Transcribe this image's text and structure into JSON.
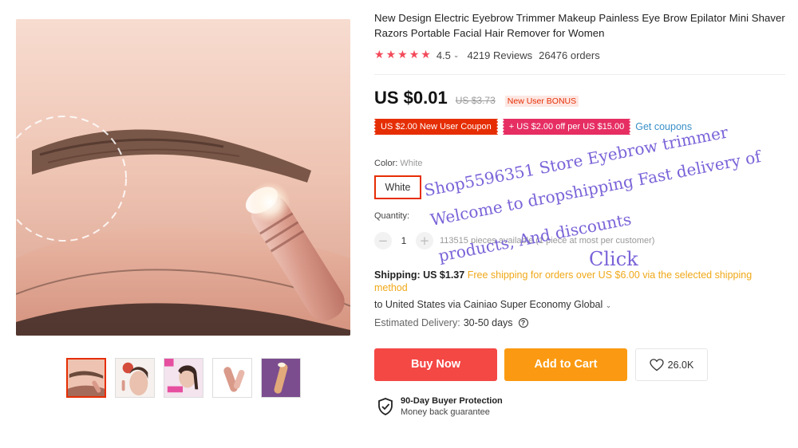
{
  "product": {
    "title": "New Design Electric Eyebrow Trimmer Makeup Painless Eye Brow Epilator Mini Shaver Razors Portable Facial Hair Remover for Women",
    "rating": "4.5",
    "reviews": "4219 Reviews",
    "orders": "26476 orders",
    "stars_filled": 5
  },
  "price": {
    "current": "US $0.01",
    "original": "US $3.73",
    "bonus_tag": "New User BONUS"
  },
  "coupons": {
    "new_user": "US $2.00 New User Coupon",
    "store": "+ US $2.00 off per US $15.00",
    "get_link": "Get coupons"
  },
  "color": {
    "label": "Color:",
    "selected": "White",
    "option": "White"
  },
  "quantity": {
    "label": "Quantity:",
    "value": "1",
    "minus": "−",
    "plus": "+",
    "stock": "113515 pieces available (1 piece at most per customer)"
  },
  "shipping": {
    "label": "Shipping: US $1.37",
    "free_text": "Free shipping for orders over US $6.00 via the selected shipping method",
    "to": "to United States via Cainiao Super Economy Global",
    "delivery_label": "Estimated Delivery:",
    "delivery_days": "30-50 days"
  },
  "actions": {
    "buy_now": "Buy Now",
    "add_to_cart": "Add to Cart",
    "wishlist_count": "26.0K"
  },
  "protection": {
    "title": "90-Day Buyer Protection",
    "subtitle": "Money back guarantee"
  },
  "overlay": {
    "line1": "Shop5596351 Store Eyebrow trimmer",
    "line2": "Welcome to dropshipping Fast delivery of",
    "line3": "products, And discounts",
    "click": "Click"
  },
  "colors": {
    "accent_red": "#e62e04",
    "buy_now": "#f44845",
    "add_to_cart": "#fb9a12",
    "link_blue": "#3a90c8",
    "overlay_purple": "#7a63d8"
  },
  "icons": [
    "star-icon",
    "chevron-down-icon",
    "help-icon",
    "heart-icon",
    "shield-check-icon"
  ]
}
